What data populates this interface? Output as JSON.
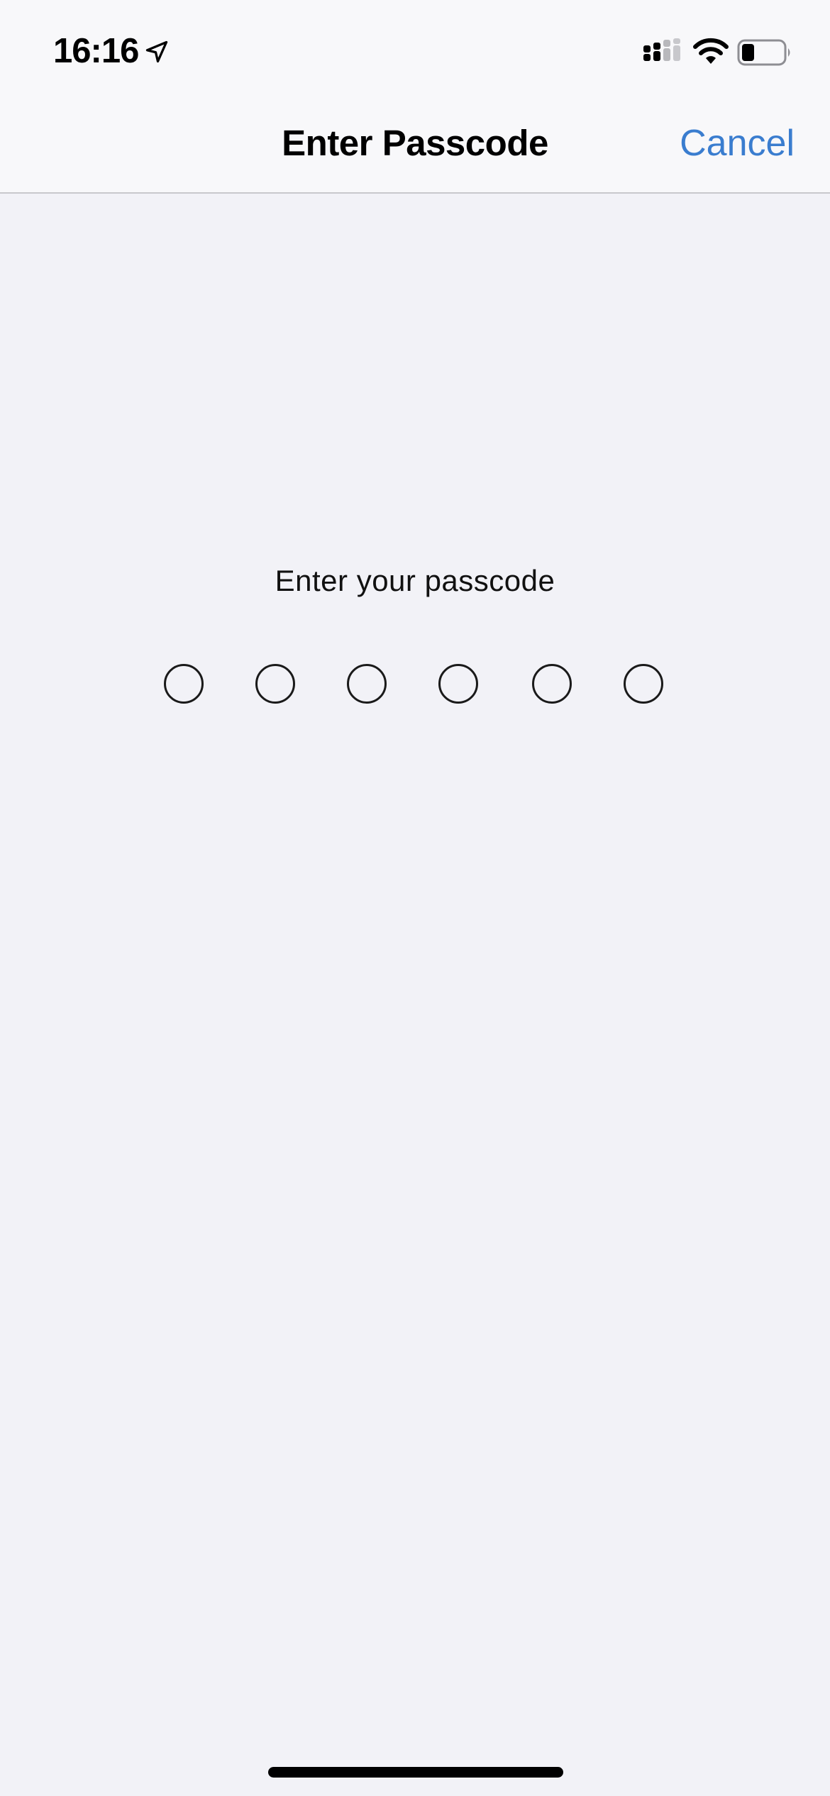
{
  "status_bar": {
    "time": "16:16",
    "location_icon": "location-arrow-icon",
    "cellular_icon": "cellular-signal-icon",
    "wifi_icon": "wifi-icon",
    "battery_icon": "battery-icon",
    "battery_level": 0.3
  },
  "nav": {
    "title": "Enter Passcode",
    "cancel_label": "Cancel"
  },
  "passcode": {
    "prompt": "Enter your passcode",
    "digits_total": 6,
    "digits_entered": 0
  },
  "colors": {
    "accent": "#3a7dcf",
    "background": "#f2f2f7",
    "nav_background": "#f8f8fa"
  }
}
